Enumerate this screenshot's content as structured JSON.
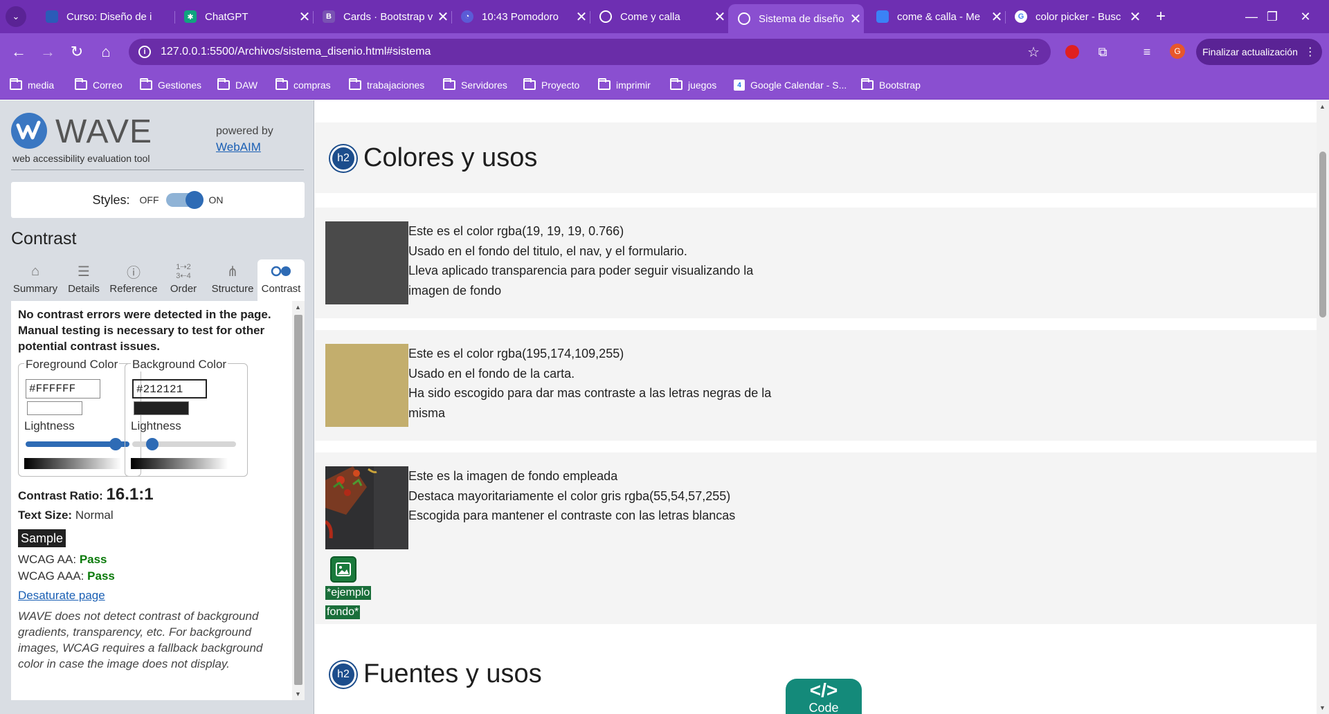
{
  "browser": {
    "tabs": [
      {
        "label": "Curso: Diseño de i",
        "favicon_color": "#2b5bb8"
      },
      {
        "label": "ChatGPT",
        "favicon_color": "#10a37f"
      },
      {
        "label": "Cards · Bootstrap v",
        "favicon_color": "#7952b3",
        "favicon_text": "B"
      },
      {
        "label": "10:43 Pomodoro",
        "favicon_color": "#5b5bd6"
      },
      {
        "label": "Come y calla",
        "favicon_color": "#d0d0d0"
      },
      {
        "label": "Sistema de diseño",
        "favicon_color": "#d0d0d0"
      },
      {
        "label": "come & calla - Me",
        "favicon_color": "#3b82f6"
      },
      {
        "label": "color picker - Busc",
        "favicon_color": "#ffffff",
        "favicon_text": "G"
      }
    ],
    "active_tab_index": 5,
    "address": "127.0.0.1:5500/Archivos/sistema_disenio.html#sistema",
    "avatar_letter": "G",
    "update_button": "Finalizar actualización",
    "bookmarks": [
      "media",
      "Correo",
      "Gestiones",
      "DAW",
      "compras",
      "trabajaciones",
      "Servidores",
      "Proyecto",
      "imprimir",
      "juegos",
      "Google Calendar - S...",
      "Bootstrap"
    ],
    "calendar_icon_text": "4",
    "tab_close_glyph": "✕",
    "new_tab_glyph": "+"
  },
  "wave": {
    "title": "WAVE",
    "subtitle": "web accessibility evaluation tool",
    "powered_by": "powered by",
    "webaim_link": "WebAIM",
    "styles_label": "Styles:",
    "styles_off": "OFF",
    "styles_on": "ON",
    "styles_enabled": true,
    "panel_title": "Contrast",
    "tabs": [
      "Summary",
      "Details",
      "Reference",
      "Order",
      "Structure",
      "Contrast"
    ],
    "active_tab": "Contrast",
    "message": "No contrast errors were detected in the page. Manual testing is necessary to test for other potential contrast issues.",
    "foreground": {
      "legend": "Foreground Color",
      "value": "#FFFFFF",
      "lightness_label": "Lightness",
      "lightness": 0.92
    },
    "background": {
      "legend": "Background Color",
      "value": "#212121",
      "lightness_label": "Lightness",
      "lightness": 0.15
    },
    "contrast_ratio_label": "Contrast Ratio:",
    "contrast_ratio_value": "16.1:1",
    "text_size_label": "Text Size:",
    "text_size_value": "Normal",
    "sample_text": "Sample",
    "wcag_aa_label": "WCAG AA:",
    "wcag_aa_result": "Pass",
    "wcag_aaa_label": "WCAG AAA:",
    "wcag_aaa_result": "Pass",
    "desaturate_link": "Desaturate page",
    "note": "WAVE does not detect contrast of background gradients, transparency, etc. For background images, WCAG requires a fallback background color in case the image does not display."
  },
  "page": {
    "h2_badge": "h2",
    "section1_title": "Colores y usos",
    "color_rows": [
      {
        "swatch": "#4a4a4a",
        "lines": [
          "Este es el color rgba(19, 19, 19, 0.766)",
          "Usado en el fondo del titulo, el nav, y el formulario.",
          "Lleva aplicado transparencia para poder seguir visualizando la",
          "imagen de fondo"
        ]
      },
      {
        "swatch": "#c3ae6d",
        "lines": [
          "Este es el color rgba(195,174,109,255)",
          "Usado en el fondo de la carta.",
          "Ha sido escogido para dar mas contraste a las letras negras de la",
          "misma"
        ]
      },
      {
        "swatch": "image",
        "lines": [
          "Este es la imagen de fondo empleada",
          "Destaca mayoritariamente el color gris rgba(55,54,57,255)",
          "Escogida para mantener el contraste con las letras blancas"
        ]
      }
    ],
    "alt_label_line1": "*ejemplo",
    "alt_label_line2": "fondo*",
    "section2_title": "Fuentes y usos",
    "code_tab_symbol": "</>",
    "code_tab_label": "Code"
  },
  "colors": {
    "chrome_dark": "#6e2fb2",
    "chrome_light": "#8a4fd0",
    "wave_blue": "#2e6bb5",
    "pass_green": "#0a7a0a",
    "h2_badge": "#1c4d8c",
    "code_tab": "#148a7a"
  }
}
